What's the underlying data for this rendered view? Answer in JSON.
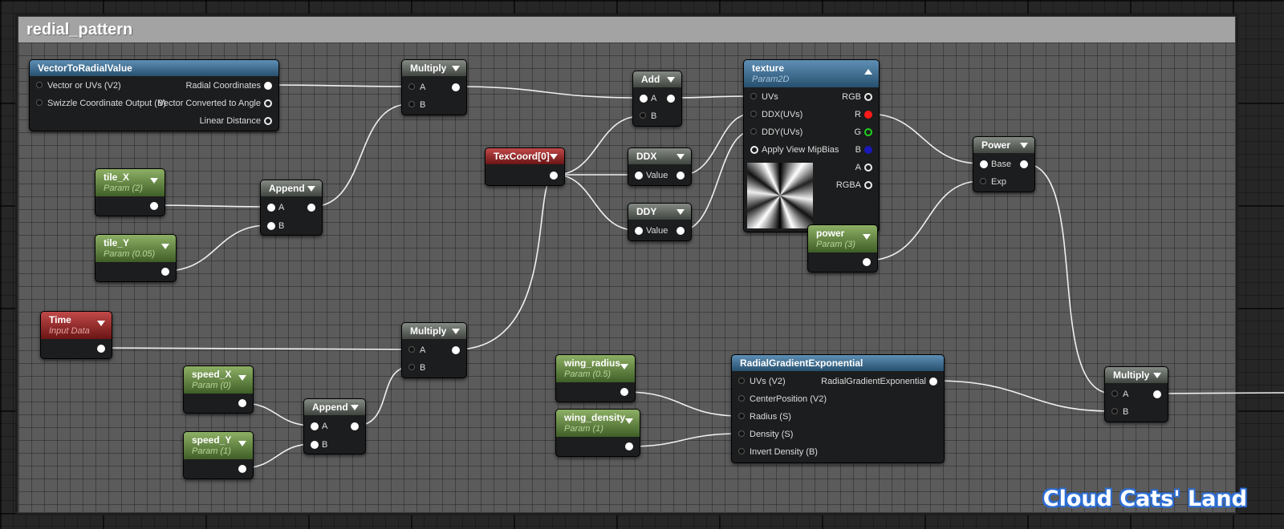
{
  "comment": {
    "title": "redial_pattern"
  },
  "nodes": {
    "vector_to_radial": {
      "title": "VectorToRadialValue",
      "inputs": [
        "Vector or UVs (V2)",
        "Swizzle Coordinate Output (B)"
      ],
      "outputs": [
        "Radial Coordinates",
        "Vector Converted to Angle",
        "Linear Distance"
      ]
    },
    "multiply_1": {
      "title": "Multiply",
      "inputs": [
        "A",
        "B"
      ]
    },
    "add": {
      "title": "Add",
      "inputs": [
        "A",
        "B"
      ]
    },
    "texture": {
      "title": "texture",
      "subtitle": "Param2D",
      "inputs": [
        "UVs",
        "DDX(UVs)",
        "DDY(UVs)",
        "Apply View MipBias"
      ],
      "outputs": [
        "RGB",
        "R",
        "G",
        "B",
        "A",
        "RGBA"
      ]
    },
    "tile_x": {
      "title": "tile_X",
      "subtitle": "Param (2)"
    },
    "tile_y": {
      "title": "tile_Y",
      "subtitle": "Param (0.05)"
    },
    "append_1": {
      "title": "Append",
      "inputs": [
        "A",
        "B"
      ]
    },
    "texcoord": {
      "title": "TexCoord[0]"
    },
    "ddx": {
      "title": "DDX",
      "inputs": [
        "Value"
      ]
    },
    "ddy": {
      "title": "DDY",
      "inputs": [
        "Value"
      ]
    },
    "power_param": {
      "title": "power",
      "subtitle": "Param (3)"
    },
    "power": {
      "title": "Power",
      "inputs": [
        "Base",
        "Exp"
      ]
    },
    "time": {
      "title": "Time",
      "subtitle": "Input Data"
    },
    "multiply_2": {
      "title": "Multiply",
      "inputs": [
        "A",
        "B"
      ]
    },
    "speed_x": {
      "title": "speed_X",
      "subtitle": "Param (0)"
    },
    "speed_y": {
      "title": "speed_Y",
      "subtitle": "Param (1)"
    },
    "append_2": {
      "title": "Append",
      "inputs": [
        "A",
        "B"
      ]
    },
    "wing_radius": {
      "title": "wing_radius",
      "subtitle": "Param (0.5)"
    },
    "wing_density": {
      "title": "wing_density",
      "subtitle": "Param (1)"
    },
    "radial_gradient": {
      "title": "RadialGradientExponential",
      "inputs": [
        "UVs (V2)",
        "CenterPosition (V2)",
        "Radius (S)",
        "Density (S)",
        "Invert Density (B)"
      ],
      "outputs": [
        "RadialGradientExponential"
      ]
    },
    "multiply_3": {
      "title": "Multiply",
      "inputs": [
        "A",
        "B"
      ]
    }
  },
  "colors": {
    "comment_header": "#a3a3a3",
    "function_header": "#27506f",
    "param_header": "#3f5e27",
    "input_header": "#6a1515",
    "math_header": "#404540",
    "wire": "#f0f0f0",
    "pin_r": "#ff1a1a",
    "pin_g": "#21d321",
    "pin_b": "#1a1ab8"
  },
  "watermark": "Cloud Cats' Land"
}
